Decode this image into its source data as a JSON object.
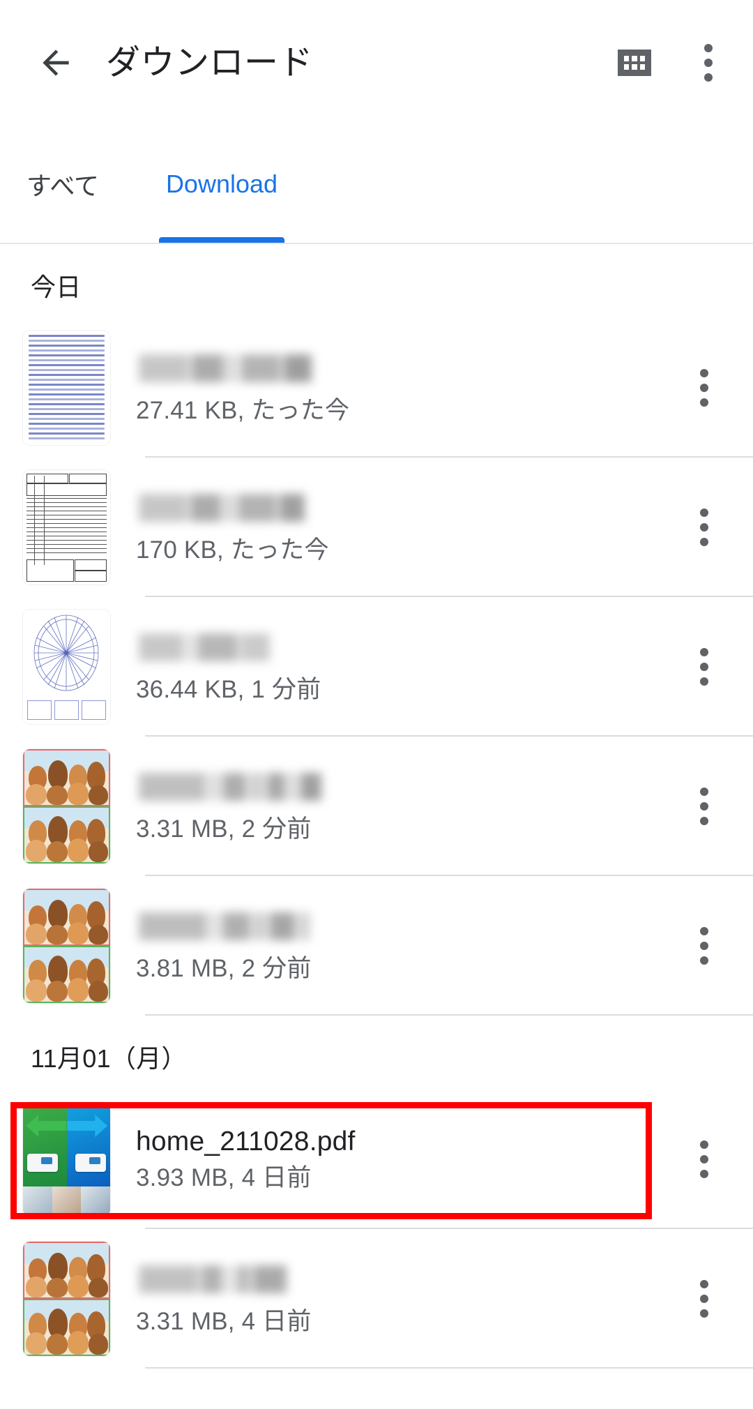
{
  "appbar": {
    "title": "ダウンロード",
    "back_icon": "arrow-left-icon",
    "grid_view_icon": "grid-view-icon",
    "overflow_icon": "more-vert-icon"
  },
  "tabs": [
    {
      "label": "すべて",
      "active": false
    },
    {
      "label": "Download",
      "active": true
    }
  ],
  "colors": {
    "accent": "#1a73e8",
    "highlight": "#ff0000",
    "text_primary": "#202124",
    "text_secondary": "#5f6368",
    "divider": "#dadce0"
  },
  "sections": [
    {
      "header": "今日",
      "items": [
        {
          "filename": "",
          "redacted": true,
          "meta": "27.41 KB, たった今",
          "thumb": "lined-document-thumbnail",
          "highlighted": false
        },
        {
          "filename": "",
          "redacted": true,
          "meta": "170 KB, たった今",
          "thumb": "form-scan-thumbnail",
          "highlighted": false
        },
        {
          "filename": "",
          "redacted": true,
          "meta": "36.44 KB, 1 分前",
          "thumb": "radial-chart-thumbnail",
          "highlighted": false
        },
        {
          "filename": "",
          "redacted": true,
          "meta": "3.31 MB, 2 分前",
          "thumb": "illustration-thumbnail",
          "highlighted": false
        },
        {
          "filename": "",
          "redacted": true,
          "meta": "3.81 MB, 2 分前",
          "thumb": "illustration-thumbnail",
          "highlighted": false
        }
      ]
    },
    {
      "header": "11月01（月）",
      "items": [
        {
          "filename": "home_211028.pdf",
          "redacted": false,
          "meta": "3.93 MB, 4 日前",
          "thumb": "printer-promo-thumbnail",
          "highlighted": true
        },
        {
          "filename": "",
          "redacted": true,
          "meta": "3.31 MB, 4 日前",
          "thumb": "illustration-thumbnail",
          "highlighted": false
        }
      ]
    }
  ]
}
